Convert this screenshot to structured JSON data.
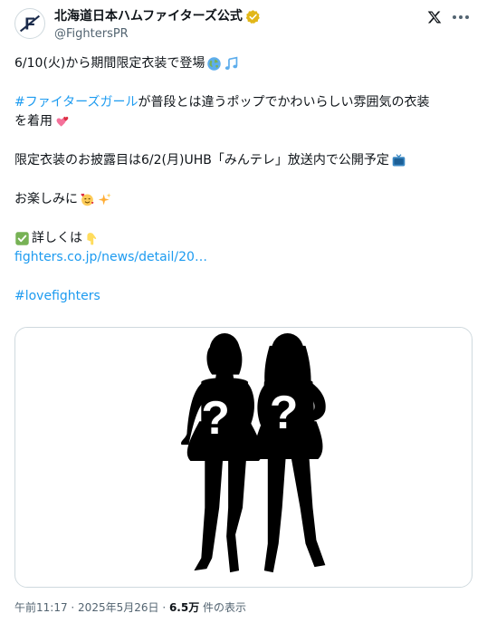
{
  "author": {
    "display_name": "北海道日本ハムファイターズ公式",
    "handle": "@FightersPR",
    "avatar_letter": "F",
    "verified": true
  },
  "tweet": {
    "line1": "6/10(火)から期間限定衣装で登場",
    "hashtag_girl": "#ファイターズガール",
    "line2_rest": " が普段とは違うポップでかわいらしい雰囲気の衣装",
    "line3": "を着用",
    "line4": "限定衣装のお披露目は6/2(月)UHB「みんテレ」放送内で公開予定",
    "line5": "お楽しみに",
    "line6": "詳しくは",
    "url": "fighters.co.jp/news/detail/20…",
    "hashtag_love": "#lovefighters"
  },
  "meta": {
    "time": "午前11:17",
    "separator": " · ",
    "date": "2025年5月26日",
    "views_count": "6.5万",
    "views_label": " 件の表示"
  },
  "colors": {
    "link": "#1d9bf0",
    "text": "#0f1419",
    "muted": "#536471",
    "verified": "#e2b719"
  }
}
